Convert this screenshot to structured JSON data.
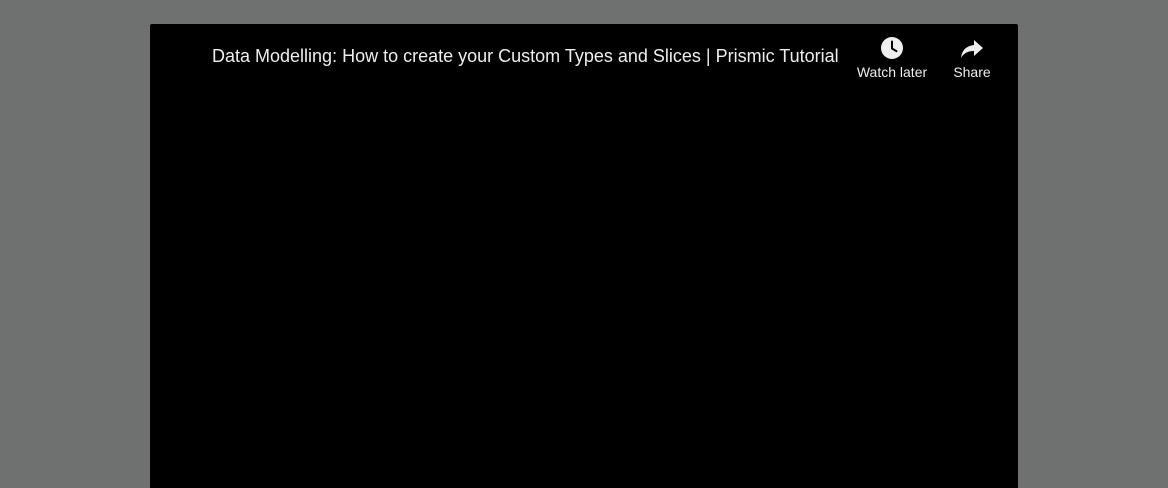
{
  "video": {
    "title": "Data Modelling: How to create your Custom Types and Slices | Prismic Tutorial"
  },
  "actions": {
    "watch_later": {
      "label": "Watch later",
      "icon": "clock-icon"
    },
    "share": {
      "label": "Share",
      "icon": "share-arrow-icon"
    }
  },
  "colors": {
    "page_background": "#6f7070",
    "player_background": "#000000",
    "text": "#eeeeee"
  }
}
